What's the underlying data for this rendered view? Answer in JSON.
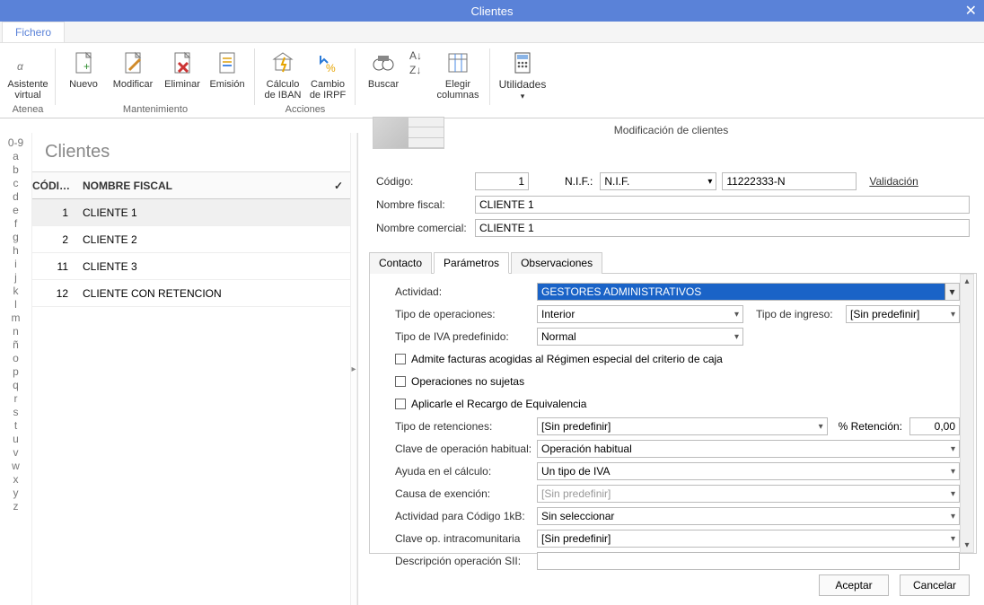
{
  "window": {
    "title": "Clientes",
    "close_glyph": "✕"
  },
  "ribbon": {
    "tab_fichero": "Fichero",
    "groups": {
      "atenea": {
        "label": "Atenea",
        "asistente": "Asistente\nvirtual"
      },
      "manten": {
        "label": "Mantenimiento",
        "nuevo": "Nuevo",
        "modificar": "Modificar",
        "eliminar": "Eliminar",
        "emision": "Emisión"
      },
      "acciones": {
        "label": "Acciones",
        "iban": "Cálculo\nde IBAN",
        "irpf": "Cambio\nde IRPF"
      },
      "buscar": {
        "buscar": "Buscar",
        "sort": "",
        "elegir": "Elegir\ncolumnas"
      },
      "util": {
        "label": "Utilidades"
      }
    }
  },
  "alphabet": [
    "0-9",
    "a",
    "b",
    "c",
    "d",
    "e",
    "f",
    "g",
    "h",
    "i",
    "j",
    "k",
    "l",
    "m",
    "n",
    "ñ",
    "o",
    "p",
    "q",
    "r",
    "s",
    "t",
    "u",
    "v",
    "w",
    "x",
    "y",
    "z"
  ],
  "list": {
    "title": "Clientes",
    "col_codi": "CÓDI…",
    "col_name": "NOMBRE FISCAL",
    "col_chk": "✓",
    "rows": [
      {
        "cod": "1",
        "name": "CLIENTE 1",
        "selected": true
      },
      {
        "cod": "2",
        "name": "CLIENTE 2"
      },
      {
        "cod": "11",
        "name": "CLIENTE 3"
      },
      {
        "cod": "12",
        "name": "CLIENTE CON RETENCION"
      }
    ]
  },
  "detail": {
    "title": "Modificación de clientes",
    "labels": {
      "codigo": "Código:",
      "nif": "N.I.F.:",
      "nombre_fiscal": "Nombre fiscal:",
      "nombre_comercial": "Nombre comercial:",
      "validacion": "Validación"
    },
    "values": {
      "codigo": "1",
      "nif_type": "N.I.F.",
      "nif": "11222333-N",
      "nombre_fiscal": "CLIENTE 1",
      "nombre_comercial": "CLIENTE 1"
    },
    "tabs": {
      "contacto": "Contacto",
      "parametros": "Parámetros",
      "observaciones": "Observaciones"
    },
    "params": {
      "actividad_l": "Actividad:",
      "actividad_v": "GESTORES ADMINISTRATIVOS",
      "tipo_op_l": "Tipo de operaciones:",
      "tipo_op_v": "Interior",
      "tipo_ing_l": "Tipo de ingreso:",
      "tipo_ing_v": "[Sin predefinir]",
      "tipo_iva_l": "Tipo de IVA predefinido:",
      "tipo_iva_v": "Normal",
      "chk_caja": "Admite facturas acogidas al Régimen especial del criterio de caja",
      "chk_nosuj": "Operaciones no sujetas",
      "chk_recargo": "Aplicarle el Recargo de Equivalencia",
      "tipo_ret_l": "Tipo de retenciones:",
      "tipo_ret_v": "[Sin predefinir]",
      "pct_ret_l": "% Retención:",
      "pct_ret_v": "0,00",
      "clave_l": "Clave de operación habitual:",
      "clave_v": "Operación habitual",
      "ayuda_l": "Ayuda en el cálculo:",
      "ayuda_v": "Un tipo de IVA",
      "causa_l": "Causa de exención:",
      "causa_v": "[Sin predefinir]",
      "act1kb_l": "Actividad para Código 1kB:",
      "act1kb_v": "Sin seleccionar",
      "intra_l": "Clave op. intracomunitaria",
      "intra_v": "[Sin predefinir]",
      "descsii_l": "Descripción operación SII:"
    }
  },
  "footer": {
    "aceptar": "Aceptar",
    "cancelar": "Cancelar"
  }
}
